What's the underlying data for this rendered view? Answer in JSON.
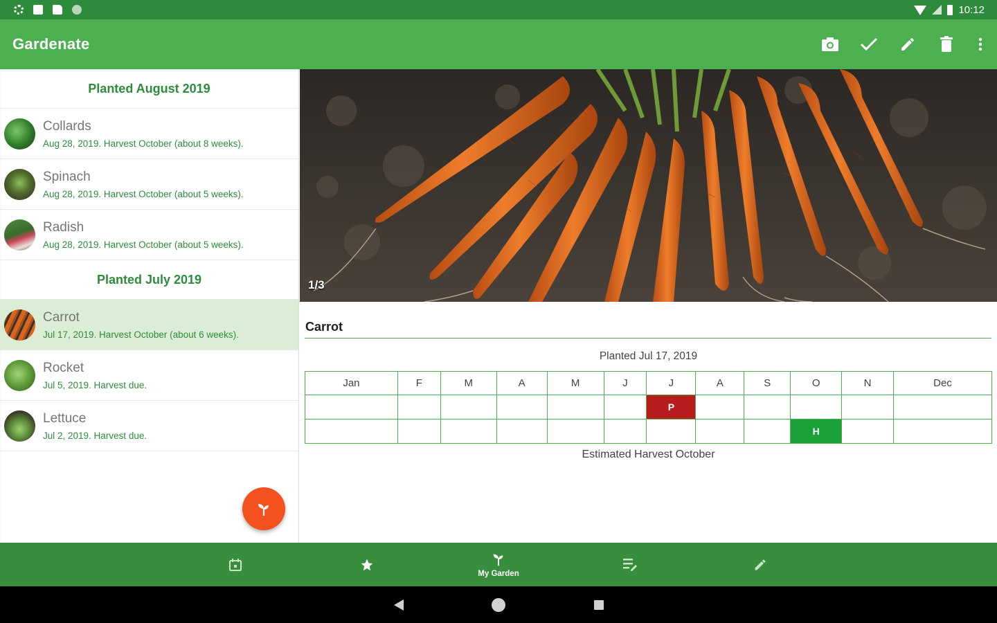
{
  "status_bar": {
    "time": "10:12"
  },
  "app": {
    "title": "Gardenate"
  },
  "actions": [
    "camera-icon",
    "check-icon",
    "edit-icon",
    "delete-icon",
    "more-icon"
  ],
  "sections": [
    {
      "header": "Planted August 2019",
      "items": [
        {
          "name": "Collards",
          "sub": "Aug 28, 2019. Harvest October (about 8 weeks)."
        },
        {
          "name": "Spinach",
          "sub": "Aug 28, 2019. Harvest October (about 5 weeks)."
        },
        {
          "name": "Radish",
          "sub": "Aug 28, 2019. Harvest October (about 5 weeks)."
        }
      ]
    },
    {
      "header": "Planted July 2019",
      "items": [
        {
          "name": "Carrot",
          "sub": "Jul 17, 2019. Harvest October (about 6 weeks).",
          "selected": true
        },
        {
          "name": "Rocket",
          "sub": "Jul 5, 2019. Harvest due."
        },
        {
          "name": "Lettuce",
          "sub": "Jul 2, 2019. Harvest due."
        }
      ]
    }
  ],
  "detail": {
    "photo_counter": "1/3",
    "title": "Carrot",
    "planted_label": "Planted Jul 17, 2019",
    "months": [
      "Jan",
      "F",
      "M",
      "A",
      "M",
      "J",
      "J",
      "A",
      "S",
      "O",
      "N",
      "Dec"
    ],
    "plant_marker": "P",
    "harvest_marker": "H",
    "harvest_label": "Estimated Harvest October"
  },
  "bottom_nav": {
    "items": [
      "calendar-icon",
      "star-icon",
      "sprout-icon",
      "notes-icon",
      "edit-icon"
    ],
    "active_label": "My Garden"
  },
  "colors": {
    "primary": "#4caf50",
    "primary_dark": "#388e3c",
    "accent": "#f4511e",
    "plant": "#b71c1c",
    "harvest": "#1aa13a"
  }
}
